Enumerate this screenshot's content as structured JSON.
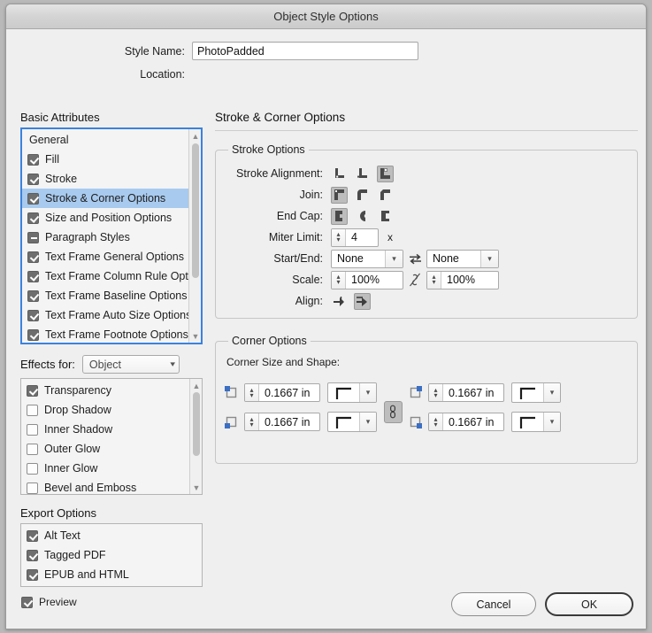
{
  "window": {
    "title": "Object Style Options"
  },
  "form": {
    "style_name_label": "Style Name:",
    "style_name_value": "PhotoPadded",
    "location_label": "Location:",
    "location_value": ""
  },
  "sidebar": {
    "basic_attributes_title": "Basic Attributes",
    "basic_attributes": [
      {
        "label": "General",
        "state": "none"
      },
      {
        "label": "Fill",
        "state": "checked"
      },
      {
        "label": "Stroke",
        "state": "checked"
      },
      {
        "label": "Stroke & Corner Options",
        "state": "checked",
        "selected": true
      },
      {
        "label": "Size and Position Options",
        "state": "checked"
      },
      {
        "label": "Paragraph Styles",
        "state": "mixed"
      },
      {
        "label": "Text Frame General Options",
        "state": "checked"
      },
      {
        "label": "Text Frame Column Rule Options",
        "state": "checked"
      },
      {
        "label": "Text Frame Baseline Options",
        "state": "checked"
      },
      {
        "label": "Text Frame Auto Size Options",
        "state": "checked"
      },
      {
        "label": "Text Frame Footnote Options",
        "state": "checked"
      }
    ],
    "effects_for_label": "Effects for:",
    "effects_for_value": "Object",
    "effects": [
      {
        "label": "Transparency",
        "state": "checked"
      },
      {
        "label": "Drop Shadow",
        "state": "unchecked"
      },
      {
        "label": "Inner Shadow",
        "state": "unchecked"
      },
      {
        "label": "Outer Glow",
        "state": "unchecked"
      },
      {
        "label": "Inner Glow",
        "state": "unchecked"
      },
      {
        "label": "Bevel and Emboss",
        "state": "unchecked"
      }
    ],
    "export_options_title": "Export Options",
    "export_options": [
      {
        "label": "Alt Text",
        "state": "checked"
      },
      {
        "label": "Tagged PDF",
        "state": "checked"
      },
      {
        "label": "EPUB and HTML",
        "state": "checked"
      }
    ]
  },
  "panel": {
    "title": "Stroke & Corner Options",
    "stroke_options": {
      "legend": "Stroke Options",
      "stroke_alignment_label": "Stroke Alignment:",
      "stroke_alignment_selected_index": 2,
      "join_label": "Join:",
      "join_selected_index": 0,
      "end_cap_label": "End Cap:",
      "end_cap_selected_index": 0,
      "miter_limit_label": "Miter Limit:",
      "miter_limit_value": "4",
      "miter_limit_unit": "x",
      "start_end_label": "Start/End:",
      "start_value": "None",
      "end_value": "None",
      "scale_label": "Scale:",
      "scale_start_value": "100%",
      "scale_end_value": "100%",
      "scale_link_state": "unlinked",
      "align_label": "Align:",
      "align_selected_index": 1
    },
    "corner_options": {
      "legend": "Corner Options",
      "subtitle": "Corner Size and Shape:",
      "link_state": "linked",
      "corners": [
        {
          "position": "top-left",
          "size": "0.1667 in",
          "shape": "none"
        },
        {
          "position": "top-right",
          "size": "0.1667 in",
          "shape": "none"
        },
        {
          "position": "bottom-left",
          "size": "0.1667 in",
          "shape": "none"
        },
        {
          "position": "bottom-right",
          "size": "0.1667 in",
          "shape": "none"
        }
      ]
    }
  },
  "footer": {
    "preview_label": "Preview",
    "preview_state": "checked",
    "cancel_label": "Cancel",
    "ok_label": "OK"
  },
  "colors": {
    "selection_blue": "#a8caee",
    "focus_blue": "#3b82e0",
    "corner_marker_blue": "#3b6fc4",
    "window_bg": "#efefef",
    "checkbox_on": "#6e6e6e"
  }
}
